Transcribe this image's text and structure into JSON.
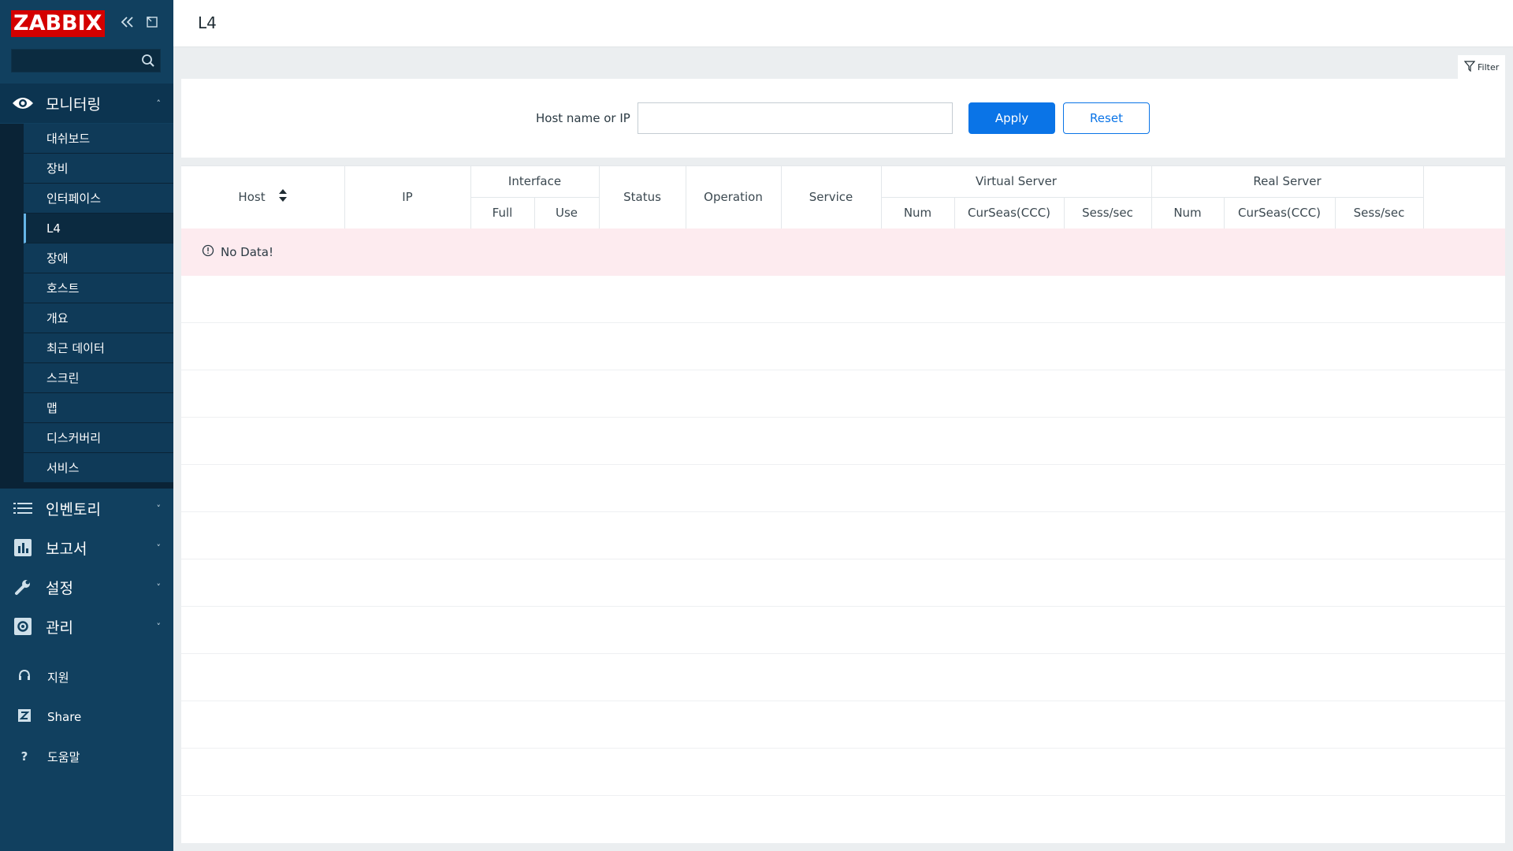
{
  "app": {
    "logo": "ZABBIX",
    "page_title": "L4"
  },
  "sidebar": {
    "sections": {
      "monitoring": "모니터링",
      "inventory": "인벤토리",
      "reports": "보고서",
      "config": "설정",
      "admin": "관리"
    },
    "submenu": [
      "대쉬보드",
      "장비",
      "인터페이스",
      "L4",
      "장애",
      "호스트",
      "개요",
      "최근 데이터",
      "스크린",
      "맵",
      "디스커버리",
      "서비스"
    ],
    "active_item": "L4",
    "utils": {
      "support": "지원",
      "share": "Share",
      "help": "도움말"
    }
  },
  "filter": {
    "tab_label": "Filter",
    "host_label": "Host name or IP",
    "host_value": "",
    "apply_label": "Apply",
    "reset_label": "Reset"
  },
  "table": {
    "headers": {
      "host": "Host",
      "ip": "IP",
      "interface": "Interface",
      "full": "Full",
      "use": "Use",
      "status": "Status",
      "operation": "Operation",
      "service": "Service",
      "virtual_server": "Virtual Server",
      "real_server": "Real Server",
      "vs_num": "Num",
      "vs_cur": "CurSeas(CCC)",
      "vs_sess": "Sess/sec",
      "rs_num": "Num",
      "rs_cur": "CurSeas(CCC)",
      "rs_sess": "Sess/sec"
    },
    "empty_message": "No Data!"
  },
  "colors": {
    "sidebar": "#11405f",
    "accent": "#0a74e7",
    "logo": "#d40000",
    "empty_row": "#fdebef"
  }
}
